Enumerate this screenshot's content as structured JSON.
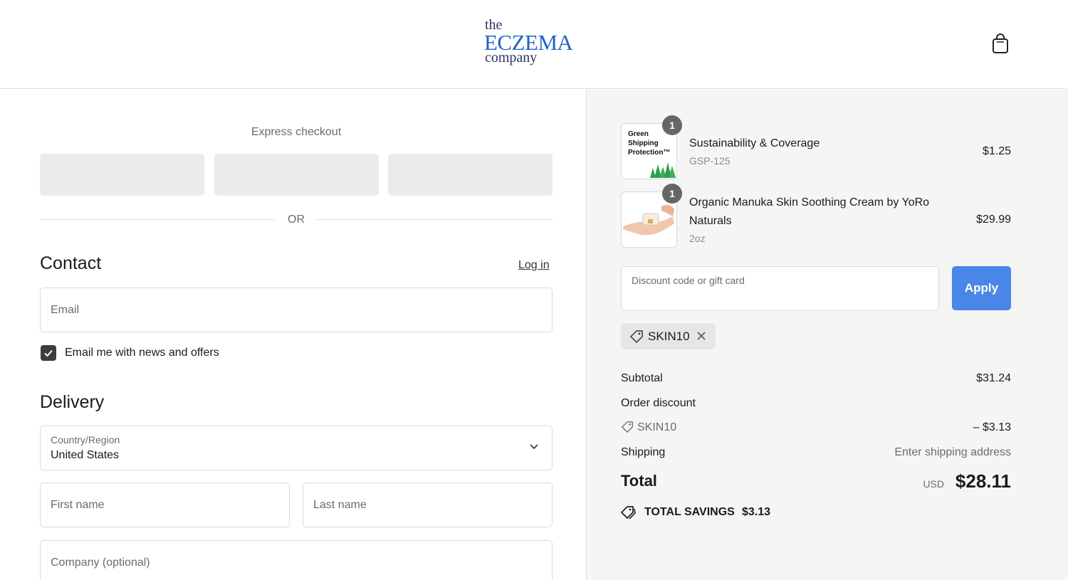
{
  "brand": {
    "logo_line1": "the",
    "logo_line2": "ECZEMA",
    "logo_line3": "company"
  },
  "colors": {
    "brand_blue": "#1f62c8",
    "apply_button": "#4a86e8",
    "summary_bg": "#f5f5f5"
  },
  "left": {
    "express_checkout_title": "Express checkout",
    "or_label": "OR",
    "contact": {
      "title": "Contact",
      "login_label": "Log in",
      "email_placeholder": "Email",
      "newsletter_label": "Email me with news and offers",
      "newsletter_checked": true
    },
    "delivery": {
      "title": "Delivery",
      "country_label": "Country/Region",
      "country_value": "United States",
      "first_name_placeholder": "First name",
      "last_name_placeholder": "Last name",
      "company_placeholder": "Company (optional)"
    }
  },
  "summary": {
    "items": [
      {
        "name": "Sustainability & Coverage",
        "subtitle": "GSP-125",
        "price": "$1.25",
        "quantity": "1",
        "thumb_text": [
          "Green",
          "Shipping",
          "Protection™"
        ]
      },
      {
        "name_line1": "Organic Manuka Skin Soothing Cream by YoRo",
        "name_line2": "Naturals",
        "subtitle": "2oz",
        "price": "$29.99",
        "quantity": "1"
      }
    ],
    "discount_placeholder": "Discount code or gift card",
    "apply_label": "Apply",
    "applied_code": "SKIN10",
    "subtotal_label": "Subtotal",
    "subtotal_value": "$31.24",
    "order_discount_label": "Order discount",
    "discount_code_label": "SKIN10",
    "discount_value": "– $3.13",
    "shipping_label": "Shipping",
    "shipping_value": "Enter shipping address",
    "total_label": "Total",
    "currency": "USD",
    "total_value": "$28.11",
    "savings_label": "TOTAL SAVINGS",
    "savings_value": "$3.13"
  }
}
